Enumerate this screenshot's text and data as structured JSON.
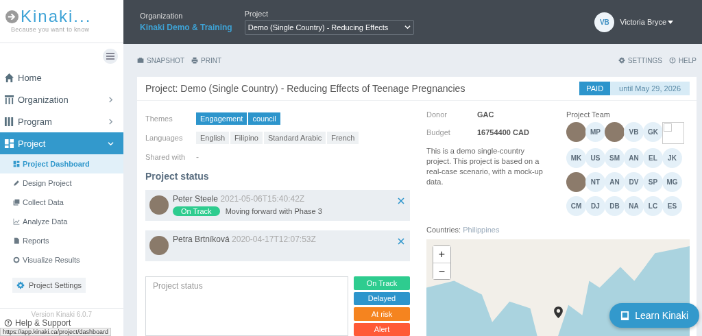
{
  "logo": {
    "name": "Kinaki...",
    "tagline": "Because you want to know"
  },
  "header": {
    "organization_label": "Organization",
    "organization": "Kinaki Demo & Training",
    "project_label": "Project",
    "project_select": "Demo (Single Country) - Reducing Effects",
    "user": {
      "initials": "VB",
      "name": "Victoria Bryce"
    }
  },
  "sidebar": {
    "items": [
      {
        "label": "Home",
        "kind": "link",
        "selected": false
      },
      {
        "label": "Organization",
        "kind": "group",
        "selected": false,
        "expanded": false
      },
      {
        "label": "Program",
        "kind": "group",
        "selected": false,
        "expanded": false
      },
      {
        "label": "Project",
        "kind": "group",
        "selected": true,
        "expanded": true,
        "children": [
          {
            "label": "Project Dashboard",
            "selected": true
          },
          {
            "label": "Design Project",
            "selected": false
          },
          {
            "label": "Collect Data",
            "selected": false
          },
          {
            "label": "Analyze Data",
            "selected": false
          },
          {
            "label": "Reports",
            "selected": false
          },
          {
            "label": "Visualize Results",
            "selected": false
          }
        ]
      }
    ],
    "settings_button": "Project Settings",
    "version": "Version Kinaki 6.0.7",
    "help": "Help & Support"
  },
  "toolbar": {
    "left": [
      "SNAPSHOT",
      "PRINT"
    ],
    "right": [
      "SETTINGS",
      "HELP"
    ]
  },
  "card": {
    "title": "Project: Demo (Single Country) - Reducing Effects of Teenage Pregnancies",
    "plan": "PAID",
    "plan_until": "until May 29, 2026",
    "themes_label": "Themes",
    "themes": [
      "Engagement",
      "council"
    ],
    "languages_label": "Languages",
    "languages": [
      "English",
      "Filipino",
      "Standard Arabic",
      "French"
    ],
    "shared_label": "Shared with",
    "shared": "-",
    "status_heading": "Project status",
    "updates": [
      {
        "kind": "on_track",
        "author": "Peter Steele",
        "time": "2021-05-06T15:40:42Z",
        "status": "On Track",
        "message": "Moving forward with Phase 3"
      },
      {
        "kind": "note",
        "author": "Petra Brtníková",
        "time": "2020-04-17T12:07:53Z"
      }
    ],
    "status_input": {
      "placeholder": "Project status"
    },
    "status_buttons": [
      {
        "label": "On Track",
        "color": "#2ecc8f"
      },
      {
        "label": "Delayed",
        "color": "#2d95cc"
      },
      {
        "label": "At risk",
        "color": "#f5841f"
      },
      {
        "label": "Alert",
        "color": "#ff5a36"
      }
    ],
    "donor_label": "Donor",
    "donor": "GAC",
    "budget_label": "Budget",
    "budget": "16754400 CAD",
    "description": "This is a demo single-country project. This project is based on a real-case scenario, with a mock-up data.",
    "team_label": "Project Team",
    "team": [
      {
        "kind": "photo"
      },
      {
        "kind": "initials",
        "initials": "MP"
      },
      {
        "kind": "photo"
      },
      {
        "kind": "initials",
        "initials": "VB"
      },
      {
        "kind": "initials",
        "initials": "GK"
      },
      {
        "kind": "broken"
      },
      {
        "kind": "initials",
        "initials": "MK"
      },
      {
        "kind": "initials",
        "initials": "US"
      },
      {
        "kind": "initials",
        "initials": "SM"
      },
      {
        "kind": "initials",
        "initials": "AN"
      },
      {
        "kind": "initials",
        "initials": "EL"
      },
      {
        "kind": "initials",
        "initials": "JK"
      },
      {
        "kind": "photo"
      },
      {
        "kind": "initials",
        "initials": "NT"
      },
      {
        "kind": "initials",
        "initials": "AN"
      },
      {
        "kind": "initials",
        "initials": "DV"
      },
      {
        "kind": "initials",
        "initials": "SP"
      },
      {
        "kind": "initials",
        "initials": "MG"
      },
      {
        "kind": "initials",
        "initials": "CM"
      },
      {
        "kind": "initials",
        "initials": "DJ"
      },
      {
        "kind": "initials",
        "initials": "DB"
      },
      {
        "kind": "initials",
        "initials": "NA"
      },
      {
        "kind": "initials",
        "initials": "LC"
      },
      {
        "kind": "initials",
        "initials": "ES"
      }
    ],
    "countries_label": "Countries:",
    "countries": "Philippines",
    "map": {
      "zoom_in": "+",
      "zoom_out": "−"
    }
  },
  "learn_button": "Learn Kinaki",
  "status_url": "https://app.kinaki.ca/project/dashboard"
}
